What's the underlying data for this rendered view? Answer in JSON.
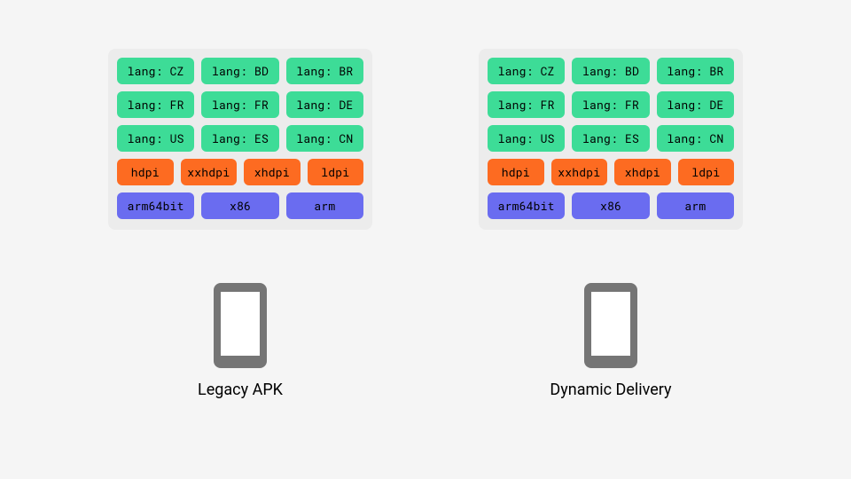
{
  "colors": {
    "lang": "#3ddc97",
    "dpi": "#fd6b21",
    "arch": "#6a6cf0",
    "panel": "#ececec",
    "bg": "#f5f5f5"
  },
  "panel": {
    "lang_rows": [
      [
        "lang: CZ",
        "lang: BD",
        "lang: BR"
      ],
      [
        "lang: FR",
        "lang: FR",
        "lang: DE"
      ],
      [
        "lang: US",
        "lang: ES",
        "lang: CN"
      ]
    ],
    "dpi_row": [
      "hdpi",
      "xxhdpi",
      "xhdpi",
      "ldpi"
    ],
    "arch_row": [
      "arm64bit",
      "x86",
      "arm"
    ]
  },
  "captions": {
    "left": "Legacy APK",
    "right": "Dynamic Delivery"
  }
}
